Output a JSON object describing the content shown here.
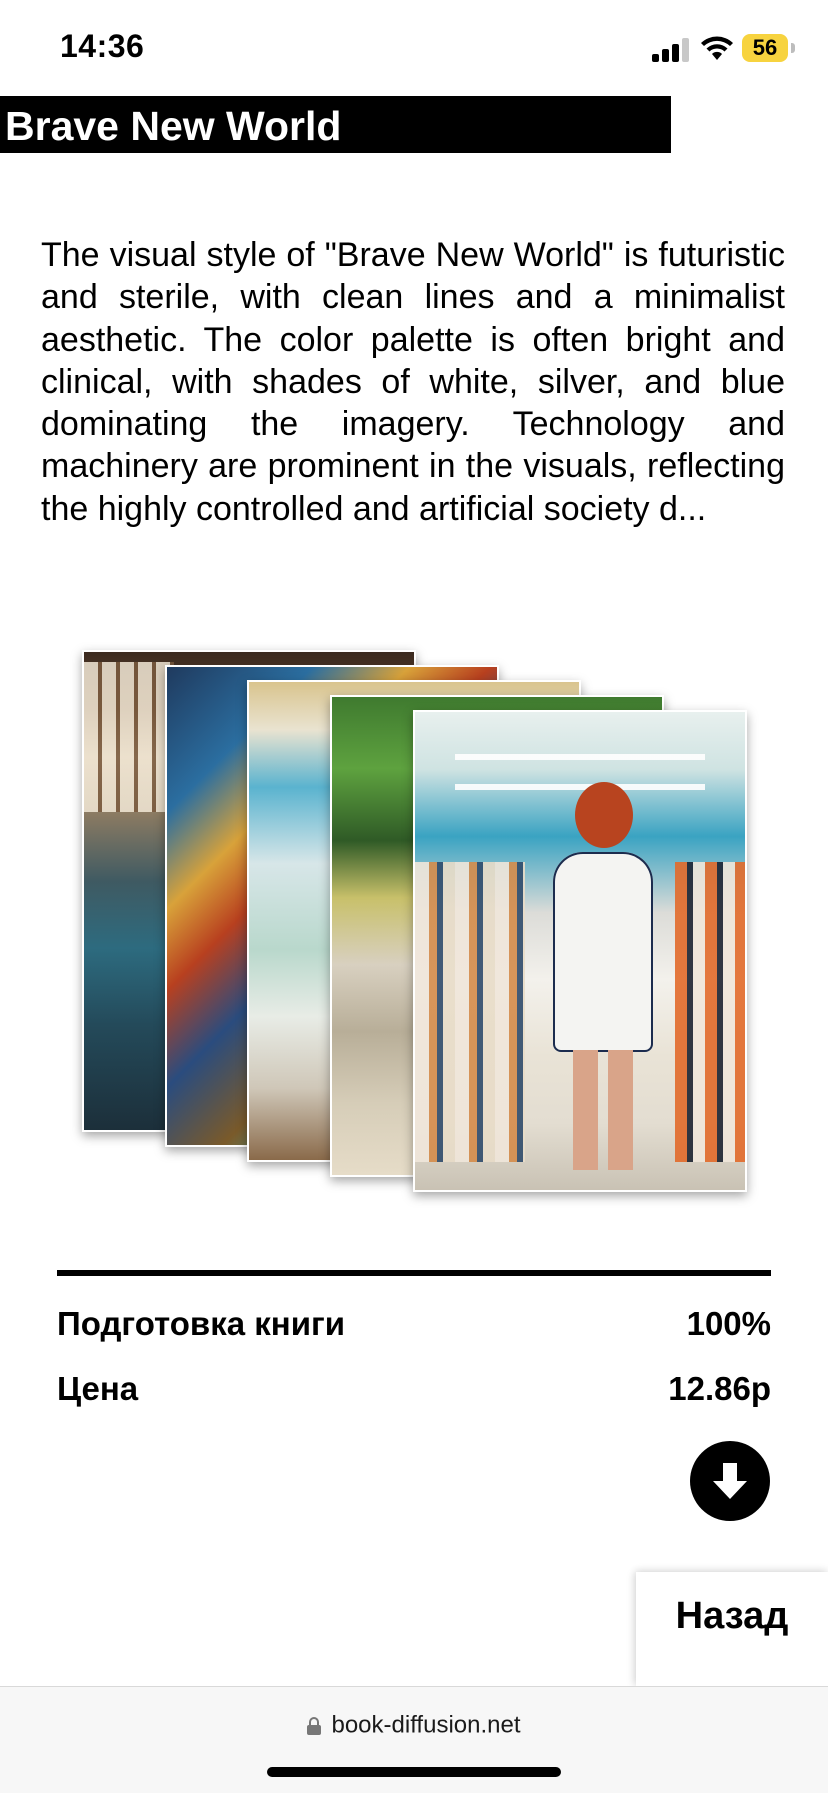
{
  "status_bar": {
    "time": "14:36",
    "battery_level": "56",
    "icons": [
      "signal-icon",
      "wifi-icon",
      "battery-icon"
    ]
  },
  "book": {
    "title": "Brave New World",
    "description": "The visual style of \"Brave New World\" is futuristic and sterile, with clean lines and a minimalist aesthetic. The color palette is often bright and clinical, with shades of white, silver, and blue dominating the imagery. Technology and machinery are prominent in the visuals, reflecting the highly controlled and artificial society d..."
  },
  "gallery": {
    "card_count": 5
  },
  "stats": {
    "progress_label": "Подготовка книги",
    "progress_value": "100%",
    "price_label": "Цена",
    "price_value": "12.86р"
  },
  "actions": {
    "download_icon": "download-arrow-icon",
    "back_label": "Назад"
  },
  "browser": {
    "url": "book-diffusion.net",
    "lock_icon": "lock-icon"
  },
  "colors": {
    "title_background": "#000000",
    "title_text": "#ffffff",
    "battery": "#f7d33f"
  }
}
